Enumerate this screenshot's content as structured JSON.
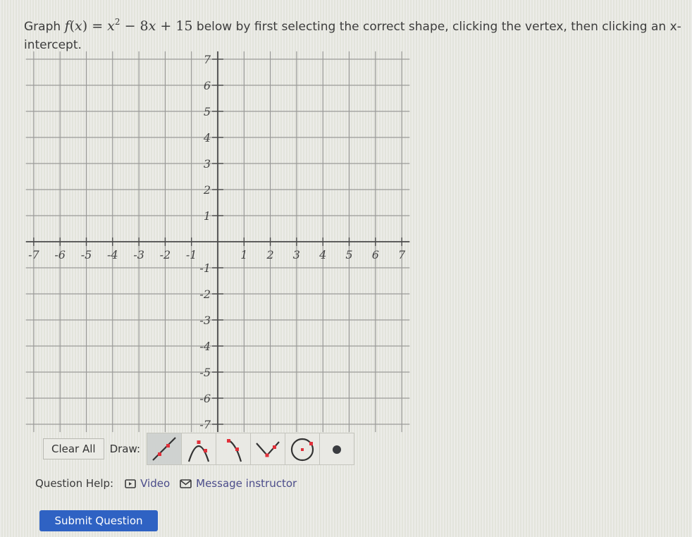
{
  "question": {
    "prefix": "Graph ",
    "function_name": "f",
    "function_var": "x",
    "equals": " = ",
    "term1_base": "x",
    "term1_exp": "2",
    "term2": " − 8",
    "term2_var": "x",
    "term3": " + 15",
    "suffix": " below by first selecting the correct shape, clicking the vertex, then clicking an x-intercept."
  },
  "graph": {
    "x_min": -7,
    "x_max": 7,
    "y_min": -7,
    "y_max": 7,
    "x_ticks": [
      "-7",
      "-6",
      "-5",
      "-4",
      "-3",
      "-2",
      "-1",
      "1",
      "2",
      "3",
      "4",
      "5",
      "6",
      "7"
    ],
    "y_ticks": [
      "7",
      "6",
      "5",
      "4",
      "3",
      "2",
      "1",
      "-1",
      "-2",
      "-3",
      "-4",
      "-5",
      "-6",
      "-7"
    ],
    "grid": true,
    "colors": {
      "grid": "#9a9a98",
      "axis": "#4a4a4a",
      "label": "#444444"
    }
  },
  "toolbar": {
    "clear_all_label": "Clear All",
    "draw_label": "Draw:",
    "tools": [
      {
        "name": "line-tool",
        "selected": true
      },
      {
        "name": "parabola-tool",
        "selected": false
      },
      {
        "name": "sqrt-tool",
        "selected": false
      },
      {
        "name": "absolute-value-tool",
        "selected": false
      },
      {
        "name": "circle-tool",
        "selected": false
      },
      {
        "name": "point-tool",
        "selected": false
      }
    ],
    "colors": {
      "handle": "#e0303a",
      "curve": "#333333"
    }
  },
  "help": {
    "label": "Question Help:",
    "video_label": "Video",
    "video_icon": "video-icon",
    "message_label": "Message instructor",
    "message_icon": "mail-icon"
  },
  "submit": {
    "label": "Submit Question",
    "color": "#2f62c3"
  }
}
